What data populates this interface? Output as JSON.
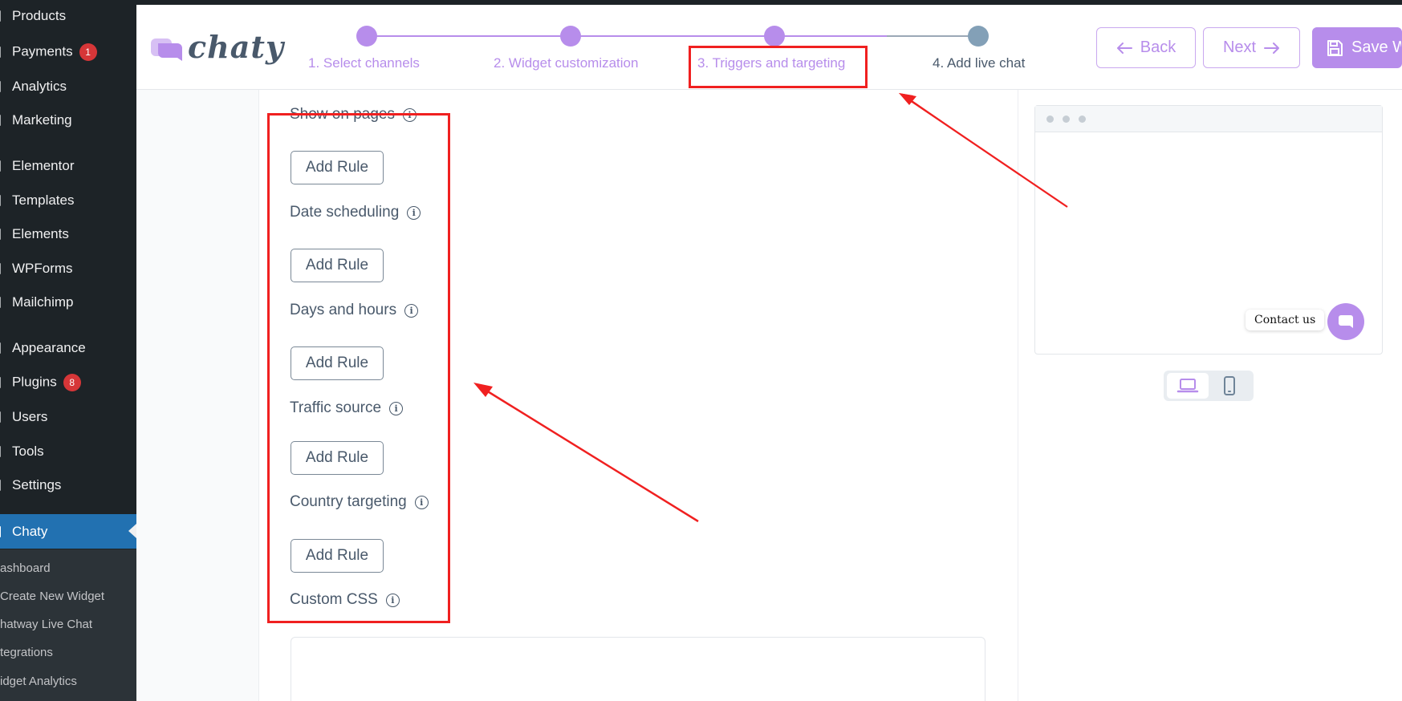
{
  "sidebar": {
    "items": [
      {
        "label": "Products",
        "badge": ""
      },
      {
        "label": "Payments",
        "badge": "1"
      },
      {
        "label": "Analytics",
        "badge": ""
      },
      {
        "label": "Marketing",
        "badge": ""
      },
      {
        "label": "Elementor",
        "badge": ""
      },
      {
        "label": "Templates",
        "badge": ""
      },
      {
        "label": "Elements",
        "badge": ""
      },
      {
        "label": "WPForms",
        "badge": ""
      },
      {
        "label": "Mailchimp",
        "badge": ""
      },
      {
        "label": "Appearance",
        "badge": ""
      },
      {
        "label": "Plugins",
        "badge": "8"
      },
      {
        "label": "Users",
        "badge": ""
      },
      {
        "label": "Tools",
        "badge": ""
      },
      {
        "label": "Settings",
        "badge": ""
      },
      {
        "label": "Chaty",
        "badge": ""
      }
    ],
    "submenu": [
      "ashboard",
      "Create New Widget",
      "hatway Live Chat",
      "tegrations",
      "idget Analytics"
    ]
  },
  "header": {
    "logo_text": "chaty",
    "steps": [
      {
        "label": "1. Select channels"
      },
      {
        "label": "2. Widget customization"
      },
      {
        "label": "3. Triggers and targeting"
      },
      {
        "label": "4. Add live chat"
      }
    ],
    "back_label": "Back",
    "next_label": "Next",
    "save_label": "Save Wi"
  },
  "form": {
    "rules": [
      {
        "label": "Show on pages",
        "button": "Add Rule"
      },
      {
        "label": "Date scheduling",
        "button": "Add Rule"
      },
      {
        "label": "Days and hours",
        "button": "Add Rule"
      },
      {
        "label": "Traffic source",
        "button": "Add Rule"
      },
      {
        "label": "Country targeting",
        "button": "Add Rule"
      }
    ],
    "custom_css_label": "Custom CSS",
    "info_glyph": "i"
  },
  "preview": {
    "contact_label": "Contact us"
  },
  "colors": {
    "accent": "#b78deb",
    "sidebar_bg": "#1d2327",
    "sidebar_current": "#2271b1",
    "annotation": "#f02020",
    "text": "#49596b"
  }
}
